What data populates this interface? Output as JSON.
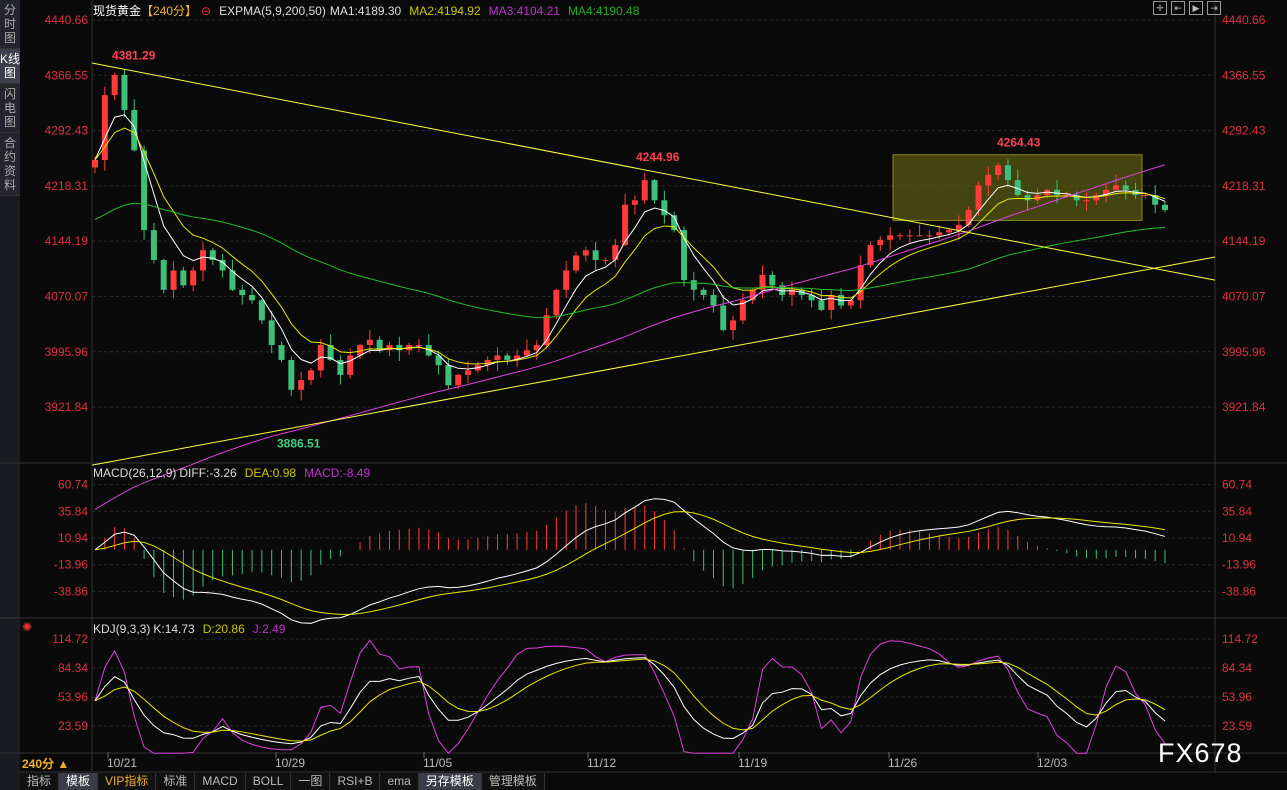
{
  "sidebar": {
    "tabs": [
      "分时图",
      "K线图",
      "闪电图",
      "合约资料"
    ]
  },
  "header": {
    "symbol": "现货黄金",
    "period": "【240分】",
    "indicator": "EXPMA(5,9,200,50)",
    "ma1": "MA1:4189.30",
    "ma2": "MA2:4194.92",
    "ma3": "MA3:4104.21",
    "ma4": "MA4:4190.48"
  },
  "macd_header": {
    "name": "MACD(26,12,9)",
    "diff": "DIFF:-3.26",
    "dea": "DEA:0.98",
    "macd": "MACD:-8.49"
  },
  "kdj_header": {
    "name": "KDJ(9,3,3)",
    "k": "K:14.73",
    "d": "D:20.86",
    "j": "J:2.49"
  },
  "period_selector": "240分 ▲",
  "toolbar": [
    "指标",
    "模板",
    "VIP指标",
    "标准",
    "MACD",
    "BOLL",
    "一图",
    "RSI+B",
    "ema",
    "另存模板",
    "管理模板"
  ],
  "window_tools": [
    "crosshair-icon",
    "zoom-left-icon",
    "play-icon",
    "move-right-icon"
  ],
  "logo": "FX678",
  "colors": {
    "up": "#ff3b3b",
    "down": "#3ec07a",
    "ma1": "#ffffff",
    "ma2": "#e8e800",
    "ma3": "#e040e0",
    "ma4": "#20c020",
    "axis": "#e03040",
    "trend": "#ffff40",
    "box": "#6a6a10"
  },
  "chart_data": [
    {
      "type": "candlestick",
      "title": "现货黄金 240分",
      "price_ticks": [
        "4440.66",
        "4366.55",
        "4292.43",
        "4218.31",
        "4144.19",
        "4070.07",
        "3995.96",
        "3921.84"
      ],
      "ylim": [
        3850,
        4445
      ],
      "x_ticks": [
        "10/21",
        "10/29",
        "11/05",
        "11/12",
        "11/19",
        "11/26",
        "12/03"
      ],
      "closes": [
        4253,
        4340,
        4367,
        4320,
        4266,
        4159,
        4119,
        4079,
        4105,
        4085,
        4105,
        4132,
        4119,
        4105,
        4079,
        4072,
        4065,
        4038,
        4005,
        3985,
        3945,
        3958,
        3971,
        4005,
        3985,
        3965,
        3991,
        4005,
        4012,
        3998,
        4005,
        3998,
        4005,
        4005,
        3991,
        3978,
        3951,
        3965,
        3971,
        3978,
        3985,
        3991,
        3985,
        3991,
        3998,
        4005,
        4045,
        4079,
        4105,
        4125,
        4132,
        4119,
        4119,
        4139,
        4193,
        4199,
        4226,
        4199,
        4179,
        4159,
        4092,
        4079,
        4072,
        4058,
        4025,
        4038,
        4065,
        4079,
        4099,
        4085,
        4072,
        4079,
        4072,
        4065,
        4052,
        4072,
        4058,
        4065,
        4112,
        4139,
        4146,
        4152,
        4152,
        4152,
        4152,
        4152,
        4156,
        4159,
        4166,
        4186,
        4219,
        4233,
        4246,
        4226,
        4206,
        4199,
        4206,
        4213,
        4206,
        4206,
        4199,
        4199,
        4206,
        4213,
        4219,
        4213,
        4206,
        4206,
        4193,
        4186
      ],
      "annotations": [
        {
          "text": "4381.29",
          "price": 4381.29
        },
        {
          "text": "3886.51",
          "price": 3886.51
        },
        {
          "text": "4244.96",
          "price": 4244.96
        },
        {
          "text": "4264.43",
          "price": 4264.43
        }
      ],
      "trendlines": [
        {
          "from": 4383,
          "to": 4092
        },
        {
          "from": 3844,
          "to": 4123
        }
      ],
      "range_box": {
        "high": 4260,
        "low": 4172
      }
    },
    {
      "type": "bar+line",
      "name": "MACD(26,12,9)",
      "ticks": [
        "60.74",
        "35.84",
        "10.94",
        "-13.96",
        "-38.86"
      ],
      "ylim": [
        -50,
        65
      ]
    },
    {
      "type": "line",
      "name": "KDJ(9,3,3)",
      "ticks": [
        "114.72",
        "84.34",
        "53.96",
        "23.59"
      ],
      "ylim": [
        0,
        120
      ]
    }
  ]
}
